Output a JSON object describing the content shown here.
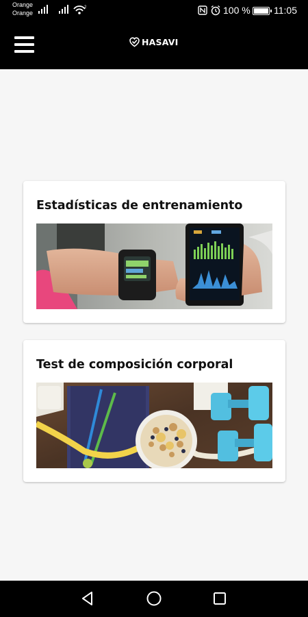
{
  "status_bar": {
    "carrier_1": "Orange",
    "carrier_2": "Orange",
    "battery_percent": "100 %",
    "time": "11:05",
    "icons": [
      "signal-icon",
      "signal-icon",
      "wifi-icon",
      "nfc-icon",
      "alarm-icon",
      "battery-icon"
    ]
  },
  "app_bar": {
    "logo_text": "HASAVI",
    "icons": [
      "menu-icon",
      "heart-shield-icon"
    ]
  },
  "cards": [
    {
      "title": "Estadísticas de entrenamiento",
      "image": "fitness-watch-and-phone-image"
    },
    {
      "title": "Test de composición corporal",
      "image": "healthy-food-and-dumbbells-image"
    }
  ],
  "nav_bar": {
    "icons": [
      "back-icon",
      "home-icon",
      "recents-icon"
    ]
  },
  "colors": {
    "bars": "#000000",
    "background": "#f6f6f6",
    "card": "#ffffff",
    "title_text": "#111111"
  }
}
